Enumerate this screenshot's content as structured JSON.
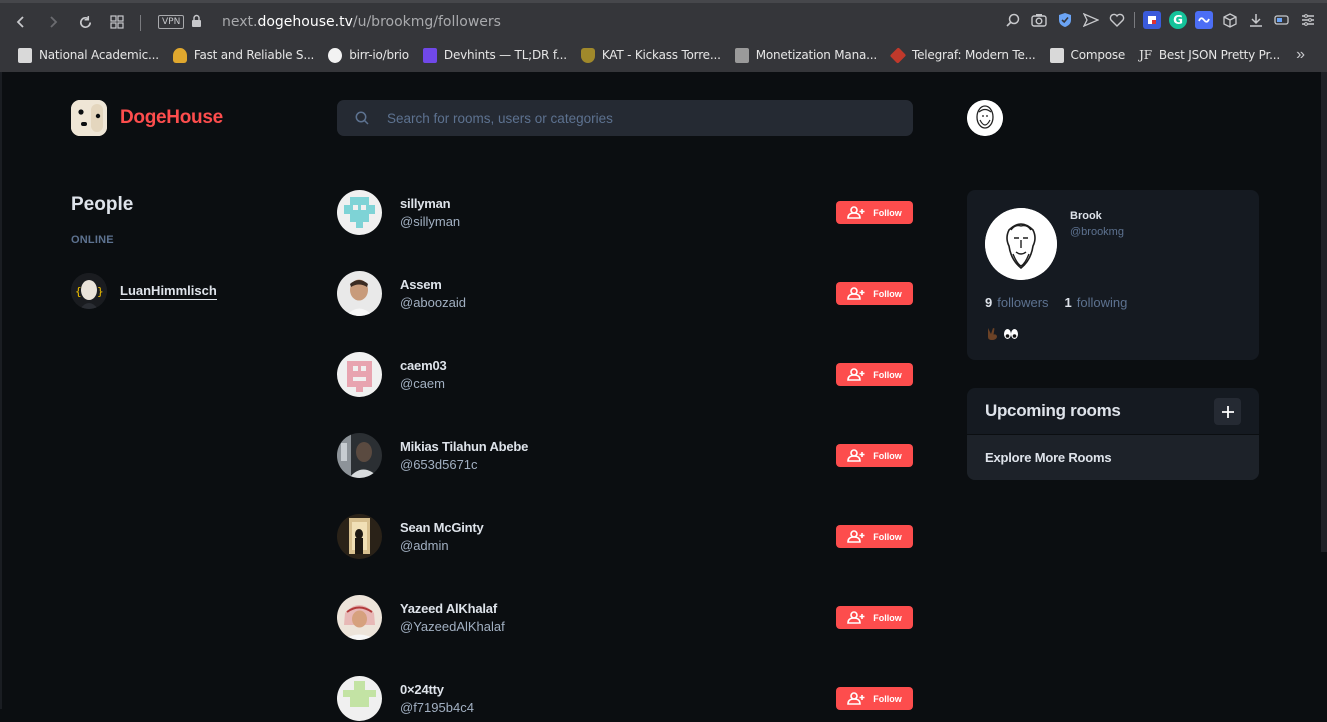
{
  "browser": {
    "vpn_label": "VPN",
    "url_prefix": "next.",
    "url_domain": "dogehouse.tv",
    "url_path": "/u/brookmg/followers",
    "bookmarks": [
      {
        "label": "National Academic...",
        "icon": "file-icon"
      },
      {
        "label": "Fast and Reliable S...",
        "icon": "trophy-icon"
      },
      {
        "label": "birr-io/brio",
        "icon": "github-icon"
      },
      {
        "label": "Devhints — TL;DR f...",
        "icon": "devhints-icon"
      },
      {
        "label": "KAT - Kickass Torre...",
        "icon": "kat-icon"
      },
      {
        "label": "Monetization Mana...",
        "icon": "printer-icon"
      },
      {
        "label": "Telegraf: Modern Te...",
        "icon": "cube-icon"
      },
      {
        "label": "Compose",
        "icon": "file-icon"
      },
      {
        "label": "Best JSON Pretty Pr...",
        "icon": "jf-icon"
      }
    ]
  },
  "app": {
    "logo_text": "DogeHouse",
    "search_placeholder": "Search for rooms, users or categories",
    "people_title": "People",
    "online_label": "ONLINE",
    "online_user": "LuanHimmlisch",
    "follow_label": "Follow",
    "followers": [
      {
        "name": "sillyman",
        "handle": "@sillyman",
        "avatar": "identicon-teal"
      },
      {
        "name": "Assem",
        "handle": "@aboozaid",
        "avatar": "photo"
      },
      {
        "name": "caem03",
        "handle": "@caem",
        "avatar": "identicon-pink"
      },
      {
        "name": "Mikias Tilahun Abebe",
        "handle": "@653d5671c",
        "avatar": "photo"
      },
      {
        "name": "Sean McGinty",
        "handle": "@admin",
        "avatar": "photo"
      },
      {
        "name": "Yazeed AlKhalaf",
        "handle": "@YazeedAlKhalaf",
        "avatar": "photo"
      },
      {
        "name": "0×24tty",
        "handle": "@f7195b4c4",
        "avatar": "identicon-green"
      }
    ],
    "profile": {
      "name": "Brook",
      "handle": "@brookmg",
      "followers_count": "9",
      "followers_label": "followers",
      "following_count": "1",
      "following_label": "following",
      "bio_emoji": "✌🏿👀"
    },
    "rooms": {
      "title": "Upcoming rooms",
      "add_label": "+",
      "explore_label": "Explore More Rooms"
    }
  },
  "colors": {
    "accent": "#fd4d4d",
    "bg": "#0b0e11",
    "card": "#151a21",
    "muted": "#5d7290"
  }
}
